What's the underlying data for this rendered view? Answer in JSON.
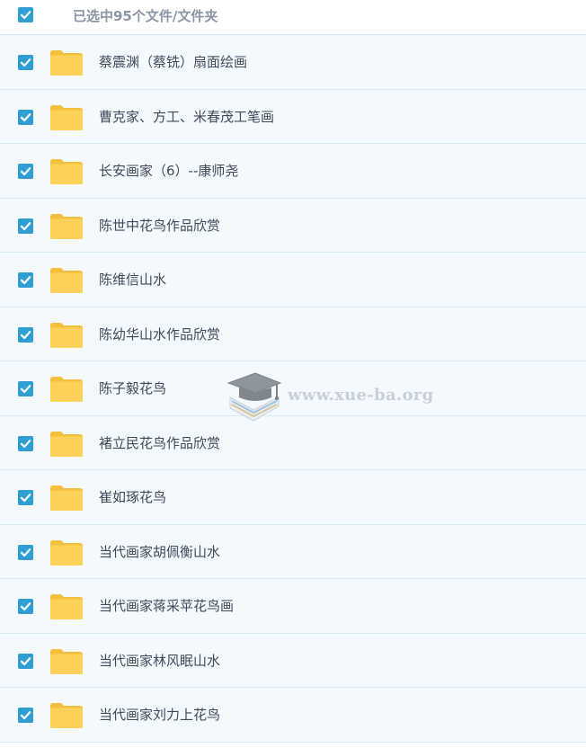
{
  "header": {
    "selection_text": "已选中95个文件/文件夹",
    "select_all_checked": true
  },
  "items": [
    {
      "label": "蔡震渊（蔡铣）扇面绘画",
      "checked": true
    },
    {
      "label": "曹克家、方工、米春茂工笔画",
      "checked": true
    },
    {
      "label": "长安画家（6）--康师尧",
      "checked": true
    },
    {
      "label": "陈世中花鸟作品欣赏",
      "checked": true
    },
    {
      "label": "陈维信山水",
      "checked": true
    },
    {
      "label": "陈幼华山水作品欣赏",
      "checked": true
    },
    {
      "label": "陈子毅花鸟",
      "checked": true
    },
    {
      "label": "褚立民花鸟作品欣赏",
      "checked": true
    },
    {
      "label": "崔如琢花鸟",
      "checked": true
    },
    {
      "label": "当代画家胡佩衡山水",
      "checked": true
    },
    {
      "label": "当代画家蒋采苹花鸟画",
      "checked": true
    },
    {
      "label": "当代画家林风眠山水",
      "checked": true
    },
    {
      "label": "当代画家刘力上花鸟",
      "checked": true
    }
  ],
  "watermark": {
    "text": "www.xue-ba.org",
    "icon": "graduation-cap-books-icon"
  },
  "colors": {
    "checkbox": "#2f9fd3",
    "folder": "#fcd15a",
    "row_background": "#f3f9fd",
    "row_divider": "#d8ebf4",
    "text": "#3f4a5a",
    "header_text": "#8a95a5"
  }
}
